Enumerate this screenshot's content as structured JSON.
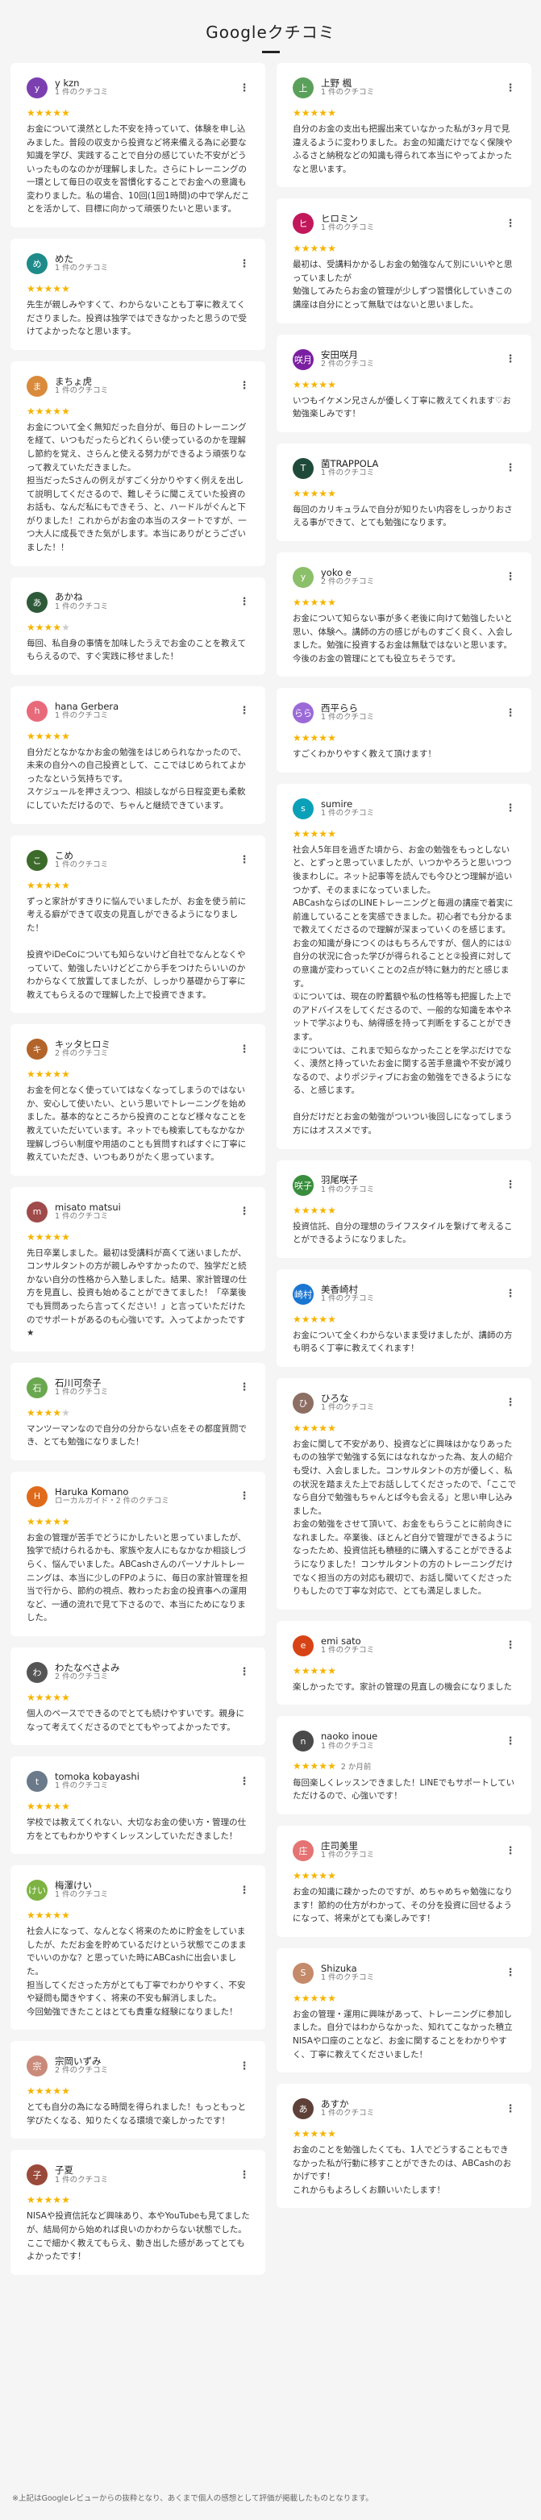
{
  "page": {
    "title": "Googleクチコミ",
    "footnote": "※上記はGoogleレビューからの抜粋となり、あくまで個人の感想として評価が掲載したものとなります。"
  },
  "colors": {
    "star": "#f6b400",
    "star_empty": "#cccccc",
    "background": "#f5f5f5"
  },
  "icons": {
    "menu": "more-vert-icon",
    "star": "star-icon"
  },
  "left_column": [
    {
      "name": "y kzn",
      "meta": "1 件のクチコミ",
      "initial": "y",
      "avatar_color": "#7b3fb0",
      "rating": 5,
      "when": "",
      "text": "お金について漠然とした不安を持っていて、体験を申し込みました。普段の収支から投資など将来備える為に必要な知識を学び、実践することで自分の感じていた不安がどういったものなのかが理解しました。さらにトレーニングの一環として毎日の収支を習慣化することでお金への意識も変わりました。私の場合、10回(1回1時間)の中で学んだことを活かして、目標に向かって頑張りたいと思います。"
    },
    {
      "name": "めた",
      "meta": "1 件のクチコミ",
      "initial": "め",
      "avatar_color": "#1e8a8a",
      "rating": 5,
      "when": "",
      "text": "先生が親しみやすくて、わからないことも丁寧に教えてくださりました。投資は独学ではできなかったと思うので受けてよかったなと思います。"
    },
    {
      "name": "まちょ虎",
      "meta": "1 件のクチコミ",
      "initial": "ま",
      "avatar_color": "#d98a3a",
      "rating": 5,
      "when": "",
      "text": "お金について全く無知だった自分が、毎日のトレーニングを経て、いつもだったらどれくらい使っているのかを理解し節約を覚え、さらんと使える努力ができるよう頑張りなって教えていただきました。\n担当だったSさんの例えがすごく分かりやすく例えを出して説明してくださるので、難しそうに聞こえていた投資のお話も、なんだ私にもできそう、と、ハードルがぐんと下がりました！これからがお金の本当のスタートですが、一つ大人に成長できた気がします。本当にありがとうございました！！"
    },
    {
      "name": "あかね",
      "meta": "1 件のクチコミ",
      "initial": "あ",
      "avatar_color": "#2e5a3a",
      "rating": 4,
      "when": "",
      "text": "毎回、私自身の事情を加味したうえでお金のことを教えてもらえるので、すぐ実践に移せました！"
    },
    {
      "name": "hana Gerbera",
      "meta": "1 件のクチコミ",
      "initial": "h",
      "avatar_color": "#e86a7a",
      "rating": 5,
      "when": "",
      "text": "自分だとなかなかお金の勉強をはじめられなかったので、未来の自分への自己投資として、ここではじめられてよかったなという気持ちです。\nスケジュールを押さえつつ、相談しながら日程変更も柔軟にしていただけるので、ちゃんと継続できています。"
    },
    {
      "name": "こめ",
      "meta": "1 件のクチコミ",
      "initial": "こ",
      "avatar_color": "#3d6b2b",
      "rating": 5,
      "when": "",
      "text": "ずっと家計がすきりに悩んでいましたが、お金を使う前に考える癖ができて収支の見直しができるようになりました！\n\n投資やiDeCoについても知らないけど自社でなんとなくやっていて、勉強したいけどどこから手をつけたらいいのかわからなくて放置してましたが、しっかり基礎から丁寧に教えてもらえるので理解した上で投資できます。"
    },
    {
      "name": "キッタヒロミ",
      "meta": "2 件のクチコミ",
      "initial": "キ",
      "avatar_color": "#b3642a",
      "rating": 5,
      "when": "",
      "text": "お金を何となく使っていてはなくなってしまうのではないか、安心して使いたい、という思いでトレーニングを始めました。基本的なところから投資のことなど様々なことを教えていただいています。ネットでも検索してもなかなか理解しづらい制度や用語のことも質問すればすぐに丁寧に教えていただき、いつもありがたく思っています。"
    },
    {
      "name": "misato matsui",
      "meta": "1 件のクチコミ",
      "initial": "m",
      "avatar_color": "#a04a4a",
      "rating": 5,
      "when": "",
      "text": "先日卒業しました。最初は受講料が高くて迷いましたが、コンサルタントの方が親しみやすかったので、独学だと続かない自分の性格から入塾しました。結果、家計管理の仕方を見直し、投資も始めることができてました！「卒業後でも質問あったら言ってください！」と言っていただけたのでサポートがあるのも心強いです。入ってよかったです★"
    },
    {
      "name": "石川可奈子",
      "meta": "1 件のクチコミ",
      "initial": "石",
      "avatar_color": "#6aa84f",
      "rating": 4,
      "when": "",
      "text": "マンツーマンなので自分の分からない点をその都度質問でき、とても勉強になりました！"
    },
    {
      "name": "Haruka Komano",
      "meta": "ローカルガイド・2 件のクチコミ",
      "initial": "H",
      "avatar_color": "#e06a1b",
      "rating": 5,
      "when": "",
      "text": "お金の管理が苦手でどうにかしたいと思っていましたが、独学で続けられるかも、家族や友人にもなかなか相談しづらく、悩んでいました。ABCashさんのパーソナルトレーニングは、本当に少しのFPのように、毎日の家計管理を担当で行から、節約の視点、教わったお金の投資事への運用など、一通の流れで見て下さるので、本当にためになりました。"
    },
    {
      "name": "わたなべさよみ",
      "meta": "2 件のクチコミ",
      "initial": "わ",
      "avatar_color": "#555555",
      "rating": 5,
      "when": "",
      "text": "個人のペースでできるのでとても続けやすいです。親身になって考えてくださるのでとてもやってよかったです。"
    },
    {
      "name": "tomoka kobayashi",
      "meta": "1 件のクチコミ",
      "initial": "t",
      "avatar_color": "#6a7a8a",
      "rating": 5,
      "when": "",
      "text": "学校では教えてくれない、大切なお金の使い方・管理の仕方をとてもわかりやすくレッスンしていただきました！"
    },
    {
      "name": "梅澤けい",
      "meta": "1 件のクチコミ",
      "initial": "けい",
      "avatar_color": "#7cb342",
      "rating": 5,
      "when": "",
      "text": "社会人になって、なんとなく将来のために貯金をしていましたが、ただお金を貯めているだけという状態でこのままでいいのかな？と思っていた時にABCashに出会いました。\n担当してくださった方がとても丁寧でわかりやすく、不安や疑問も聞きやすく、将来の不安も解消しました。\n今回勉強できたことはとても貴重な経験になりました！"
    },
    {
      "name": "宗岡いずみ",
      "meta": "2 件のクチコミ",
      "initial": "宗",
      "avatar_color": "#c98a7a",
      "rating": 5,
      "when": "",
      "text": "とても自分の為になる時間を得られました！もっともっと学びたくなる、知りたくなる環境で楽しかったです！"
    },
    {
      "name": "子夏",
      "meta": "1 件のクチコミ",
      "initial": "子",
      "avatar_color": "#9a4a3a",
      "rating": 5,
      "when": "",
      "text": "NISAや投資信託など興味あり、本やYouTubeも見てましたが、結局何から始めれば良いのかわからない状態でした。ここで細かく教えてもらえ、動き出した感があってとてもよかったです！"
    }
  ],
  "right_column": [
    {
      "name": "上野 楓",
      "meta": "1 件のクチコミ",
      "initial": "上",
      "avatar_color": "#5aa05a",
      "rating": 5,
      "when": "",
      "text": "自分のお金の支出も把握出来ていなかった私が3ヶ月で見違えるように変わりました。お金の知識だけでなく保険やふるさと納税などの知識も得られて本当にやってよかったなと思います。"
    },
    {
      "name": "ヒロミン",
      "meta": "1 件のクチコミ",
      "initial": "ヒ",
      "avatar_color": "#c2185b",
      "rating": 5,
      "when": "",
      "text": "最初は、受講料かかるしお金の勉強なんて別にいいやと思っていましたが\n勉強してみたらお金の管理が少しずつ習慣化していきこの講座は自分にとって無駄ではないと思いました。"
    },
    {
      "name": "安田咲月",
      "meta": "2 件のクチコミ",
      "initial": "咲月",
      "avatar_color": "#7b1fa2",
      "rating": 5,
      "when": "",
      "text": "いつもイケメン兄さんが優しく丁寧に教えてくれます♡お勉強楽しみです！"
    },
    {
      "name": "菌TRAPPOLA",
      "meta": "1 件のクチコミ",
      "initial": "T",
      "avatar_color": "#1f4a3a",
      "rating": 5,
      "when": "",
      "text": "毎回のカリキュラムで自分が知りたい内容をしっかりおさえる事ができて、とても勉強になります。"
    },
    {
      "name": "yoko e",
      "meta": "2 件のクチコミ",
      "initial": "y",
      "avatar_color": "#8bbf6a",
      "rating": 5,
      "when": "",
      "text": "お金について知らない事が多く老後に向けて勉強したいと思い、体験へ。講師の方の感じがものすごく良く、入会しました。勉強に投資するお金は無駄ではないと思います。今後のお金の管理にとても役立ちそうです。"
    },
    {
      "name": "西平らら",
      "meta": "1 件のクチコミ",
      "initial": "らら",
      "avatar_color": "#9c6ad8",
      "rating": 5,
      "when": "",
      "text": "すごくわかりやすく教えて頂けます！"
    },
    {
      "name": "sumire",
      "meta": "1 件のクチコミ",
      "initial": "s",
      "avatar_color": "#0aa0b8",
      "rating": 5,
      "when": "",
      "text": "社会人5年目を過ぎた頃から、お金の勉強をもっとしないと、とずっと思っていましたが、いつかやろうと思いつつ後まわしに。ネット記事等を読んでも今ひとつ理解が追いつかず、そのままになっていました。\nABCashならばのLINEトレーニングと毎週の講座で着実に前進していることを実感できました。初心者でも分かるまで教えてくださるので理解が深まっていくのを感じます。\nお金の知識が身につくのはもちろんですが、個人的には①自分の状況に合った学びが得られることと②投資に対しての意識が変わっていくことの2点が特に魅力的だと感じます。\n①については、現在の貯蓄額や私の性格等も把握した上でのアドバイスをしてくださるので、一般的な知識を本やネットで学ぶよりも、納得感を持って判断をすることができます。\n②については、これまで知らなかったことを学ぶだけでなく、漠然と持っていたお金に関する苦手意識や不安が減りなるので、よりポジティブにお金の勉強をできるようになる、と感じます。\n\n自分だけだとお金の勉強がついつい後回しになってしまう方にはオススメです。"
    },
    {
      "name": "羽尾咲子",
      "meta": "1 件のクチコミ",
      "initial": "咲子",
      "avatar_color": "#388e3c",
      "rating": 5,
      "when": "",
      "text": "投資信託、自分の理想のライフスタイルを繋げて考えることができるようになりました。"
    },
    {
      "name": "美香崎村",
      "meta": "1 件のクチコミ",
      "initial": "崎村",
      "avatar_color": "#1976d2",
      "rating": 5,
      "when": "",
      "text": "お金について全くわからないまま受けましたが、講師の方も明るく丁寧に教えてくれます！"
    },
    {
      "name": "ひろな",
      "meta": "1 件のクチコミ",
      "initial": "ひ",
      "avatar_color": "#8d6e63",
      "rating": 5,
      "when": "",
      "text": "お金に関して不安があり、投資などに興味はかなりあったものの独学で勉強する気にはなれなかった為、友人の紹介も受け、入会しました。コンサルタントの方が優しく、私の状況を踏まえた上でお話ししてくださったので、「ここでなら自分で勉強もちゃんとば今も会える」と思い申し込みました。\nお金の勉強をさせて頂いて、お金をもらうことに前向きになれました。卒業後、ほとんど自分で管理ができるようになったため、投資信託も積極的に購入することができるようになりました！コンサルタントの方のトレーニングだけでなく担当の方の対応も親切で、お話し聞いてくださったりもしたので丁寧な対応で、とても満足しました。"
    },
    {
      "name": "emi sato",
      "meta": "1 件のクチコミ",
      "initial": "e",
      "avatar_color": "#d84315",
      "rating": 5,
      "when": "",
      "text": "楽しかったです。家計の管理の見直しの機会になりました"
    },
    {
      "name": "naoko inoue",
      "meta": "1 件のクチコミ",
      "initial": "n",
      "avatar_color": "#4a4a4a",
      "rating": 5,
      "when": "2 か月前",
      "text": "毎回楽しくレッスンできました！LINEでもサポートしていただけるので、心強いです！"
    },
    {
      "name": "庄司美里",
      "meta": "1 件のクチコミ",
      "initial": "庄",
      "avatar_color": "#e57373",
      "rating": 5,
      "when": "",
      "text": "お金の知識に疎かったのですが、めちゃめちゃ勉強になります！節約の仕方がわかって、その分を投資に回せるようになって、将来がとても楽しみです！"
    },
    {
      "name": "Shizuka",
      "meta": "1 件のクチコミ",
      "initial": "S",
      "avatar_color": "#c48a6a",
      "rating": 5,
      "when": "",
      "text": "お金の管理・運用に興味があって、トレーニングに参加しました。自分ではわからなかった、知れてこなかった積立NISAや口座のことなど、お金に関することをわかりやすく、丁寧に教えてくださいました！"
    },
    {
      "name": "あすか",
      "meta": "1 件のクチコミ",
      "initial": "あ",
      "avatar_color": "#5d4037",
      "rating": 5,
      "when": "",
      "text": "お金のことを勉強したくても、1人でどうすることもできなかった私が行動に移すことができたのは、ABCashのおかげです！\nこれからもよろしくお願いいたします！"
    }
  ]
}
